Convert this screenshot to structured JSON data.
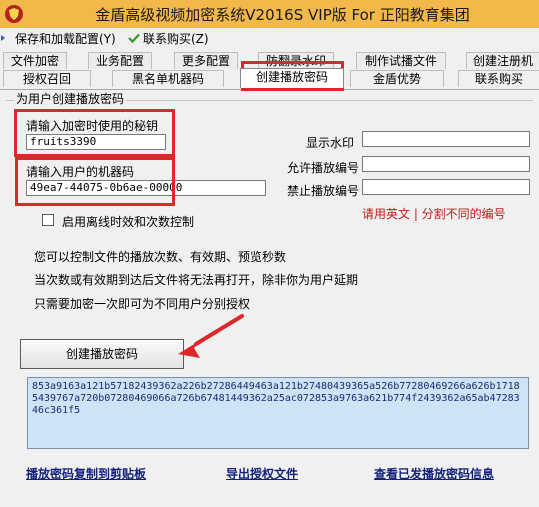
{
  "window": {
    "title": "金盾高级视频加密系统V2016S VIP版 For 正阳教育集团"
  },
  "toolbar": {
    "save_load": "保存和加载配置(Y)",
    "contact": "联系购买(Z)"
  },
  "tabs_row1": [
    "文件加密",
    "业务配置",
    "更多配置",
    "防翻录水印",
    "制作试播文件",
    "创建注册机"
  ],
  "tabs_row2": [
    "授权召回",
    "黑名单机器码",
    "创建播放密码",
    "金盾优势",
    "联系购买"
  ],
  "section": {
    "title": "为用户创建播放密码"
  },
  "form": {
    "key_label": "请输入加密时使用的秘钥",
    "key_value": "fruits3390",
    "machine_label": "请输入用户的机器码",
    "machine_value": "49ea7-44075-0b6ae-00000",
    "watermark_label": "显示水印",
    "watermark_value": "",
    "allow_label": "允许播放编号",
    "allow_value": "",
    "deny_label": "禁止播放编号",
    "deny_value": "",
    "hint": "请用英文 | 分割不同的编号",
    "offline_label": "启用离线时效和次数控制"
  },
  "info": {
    "line1": "您可以控制文件的播放次数、有效期、预览秒数",
    "line2": "当次数或有效期到达后文件将无法再打开，除非你为用户延期",
    "line3": "只需要加密一次即可为不同用户分别授权"
  },
  "actions": {
    "create": "创建播放密码"
  },
  "output": {
    "text": "853a9163a121b57182439362a226b27286449463a121b27480439365a526b77280469266a626b17185439767a720b07280469066a726b67481449362a25ac072853a9763a621b774f2439362a65ab4728346c361f5"
  },
  "links": {
    "copy": "播放密码复制到剪贴板",
    "export": "导出授权文件",
    "view": "查看已发播放密码信息"
  },
  "colors": {
    "titlebar": "#f2b84a",
    "highlight": "#e0262b",
    "output_bg": "#cfe3f7",
    "hint": "#c41a1a",
    "link": "#14217a"
  }
}
